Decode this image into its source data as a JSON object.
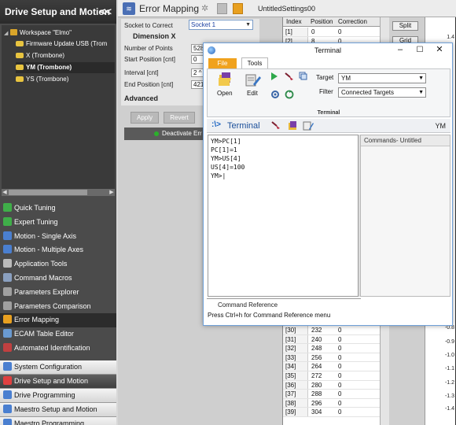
{
  "sidebar": {
    "title": "Drive Setup and Motion",
    "collapse_glyph": "<<",
    "tree": [
      {
        "label": "Workspace \"Elmo\"",
        "icon": "folder-icon"
      },
      {
        "label": "Firmware Update USB (Trom",
        "icon": "drive-icon"
      },
      {
        "label": "X (Trombone)",
        "icon": "drive-icon"
      },
      {
        "label": "YM (Trombone)",
        "icon": "drive-icon",
        "selected": true
      },
      {
        "label": "YS (Trombone)",
        "icon": "drive-icon"
      }
    ],
    "tools": [
      {
        "label": "Quick Tuning",
        "color": "#3fae49"
      },
      {
        "label": "Expert Tuning",
        "color": "#3fae49"
      },
      {
        "label": "Motion - Single Axis",
        "color": "#4a7fd0"
      },
      {
        "label": "Motion - Multiple Axes",
        "color": "#4a7fd0"
      },
      {
        "label": "Application Tools",
        "color": "#bbbbbb"
      },
      {
        "label": "Command Macros",
        "color": "#8aa0c0"
      },
      {
        "label": "Parameters Explorer",
        "color": "#a0a0a0"
      },
      {
        "label": "Parameters Comparison",
        "color": "#a0a0a0"
      },
      {
        "label": "Error Mapping",
        "color": "#e8a020",
        "selected": true
      },
      {
        "label": "ECAM Table Editor",
        "color": "#6a9ad0"
      },
      {
        "label": "Automated Identification",
        "color": "#c04040"
      }
    ],
    "groups": [
      {
        "label": "System Configuration",
        "active": false
      },
      {
        "label": "Drive Setup and Motion",
        "active": true
      },
      {
        "label": "Drive Programming",
        "active": false
      },
      {
        "label": "Maestro Setup and Motion",
        "active": false
      },
      {
        "label": "Maestro Programming",
        "active": false
      }
    ]
  },
  "main": {
    "title": "Error Mapping",
    "settings_name": "UntitledSettings00",
    "form": {
      "socket_label": "Socket to Correct",
      "socket_value": "Socket 1",
      "dimension": "Dimension X",
      "fields": [
        {
          "label": "Number of Points",
          "value": "528"
        },
        {
          "label": "Start Position [cnt]",
          "value": "0"
        },
        {
          "label": "Interval [cnt]",
          "value": "2 ^"
        },
        {
          "label": "End Position [cnt]",
          "value": "421"
        }
      ],
      "advanced": "Advanced"
    },
    "buttons": {
      "apply": "Apply",
      "revert": "Revert",
      "deactivate": "Deactivate Err"
    },
    "table": {
      "headers": [
        "Index",
        "Position",
        "Correction"
      ],
      "top_rows": [
        {
          "index": "[1]",
          "position": "0",
          "correction": "0"
        },
        {
          "index": "[2]",
          "position": "8",
          "correction": "0"
        }
      ],
      "bottom_rows": [
        {
          "index": "[30]",
          "position": "232",
          "correction": "0"
        },
        {
          "index": "[31]",
          "position": "240",
          "correction": "0"
        },
        {
          "index": "[32]",
          "position": "248",
          "correction": "0"
        },
        {
          "index": "[33]",
          "position": "256",
          "correction": "0"
        },
        {
          "index": "[34]",
          "position": "264",
          "correction": "0"
        },
        {
          "index": "[35]",
          "position": "272",
          "correction": "0"
        },
        {
          "index": "[36]",
          "position": "280",
          "correction": "0"
        },
        {
          "index": "[37]",
          "position": "288",
          "correction": "0"
        },
        {
          "index": "[38]",
          "position": "296",
          "correction": "0"
        },
        {
          "index": "[39]",
          "position": "304",
          "correction": "0"
        }
      ]
    },
    "split_label": "Split",
    "grid_label": "Grid",
    "chart_ticks": [
      "1.4",
      "-0.8",
      "-0.9",
      "-1.0",
      "-1.1",
      "-1.2",
      "-1.3",
      "-1.4"
    ]
  },
  "terminal": {
    "title": "Terminal",
    "tabs": {
      "file": "File",
      "tools": "Tools"
    },
    "ribbon": {
      "open": "Open",
      "edit": "Edit",
      "target_label": "Target",
      "target_value": "YM",
      "filter_label": "Filter",
      "filter_value": "Connected Targets",
      "group_label": "Terminal"
    },
    "panel_title": "Terminal",
    "panel_glyph": ":\\>",
    "target_tag": "YM",
    "console_lines": [
      "YM>PC[1]",
      "PC[1]=1",
      "YM>US[4]",
      "US[4]=100",
      "YM>|"
    ],
    "commands_title": "Commands- Untitled",
    "cmdref_title": "Command Reference",
    "cmdref_hint": "Press Ctrl+h for Command Reference menu",
    "window_buttons": {
      "minimize": "–",
      "maximize": "☐",
      "close": "✕"
    }
  }
}
